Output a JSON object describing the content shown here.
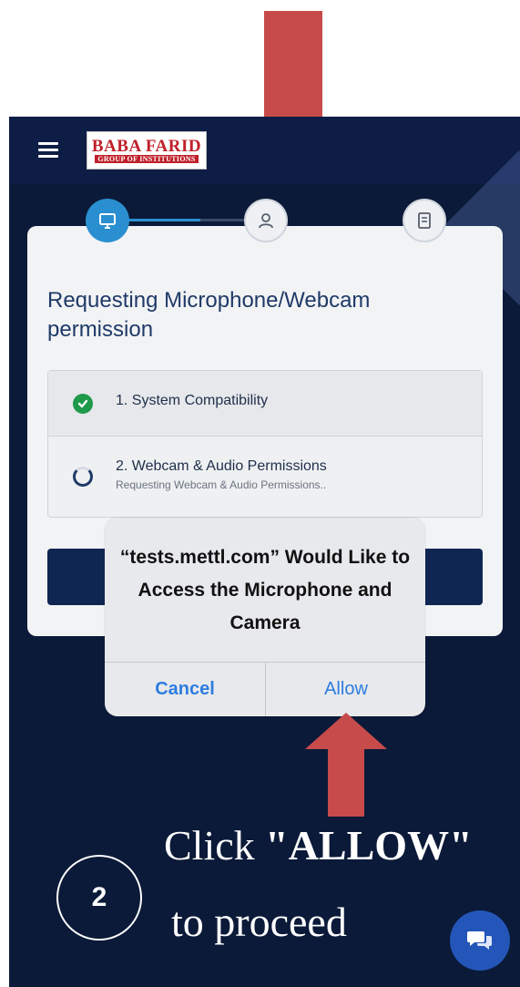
{
  "header": {
    "menu_icon": "hamburger-icon",
    "logo": {
      "main": "BABA FARID",
      "sub": "GROUP OF INSTITUTIONS"
    }
  },
  "stepper": {
    "steps": [
      {
        "icon": "monitor-icon",
        "state": "active"
      },
      {
        "icon": "user-icon",
        "state": "pending"
      },
      {
        "icon": "document-icon",
        "state": "pending"
      }
    ]
  },
  "card": {
    "title": "Requesting Microphone/Webcam permission",
    "checks": [
      {
        "label": "1. System Compatibility",
        "status": "done",
        "icon": "check-circle-icon"
      },
      {
        "label": "2. Webcam & Audio Permissions",
        "sub": "Requesting Webcam & Audio Permissions..",
        "status": "loading",
        "icon": "spinner-icon"
      }
    ]
  },
  "alert": {
    "message": "“tests.mettl.com” Would Like to Access the Microphone and Camera",
    "cancel_label": "Cancel",
    "allow_label": "Allow"
  },
  "instruction": {
    "line1_prefix": "Click ",
    "line1_emphasis": "\"ALLOW\"",
    "line2": "to proceed",
    "step_number": "2"
  },
  "colors": {
    "screen_bg": "#0b1a38",
    "header_bg": "#0d1d45",
    "accent_blue": "#2a8fd0",
    "title_blue": "#1f3a68",
    "success_green": "#1f9a4a",
    "ios_blue": "#2d7de0",
    "arrow_red": "#c74b4b"
  },
  "chat": {
    "icon": "chat-bubbles-icon"
  }
}
